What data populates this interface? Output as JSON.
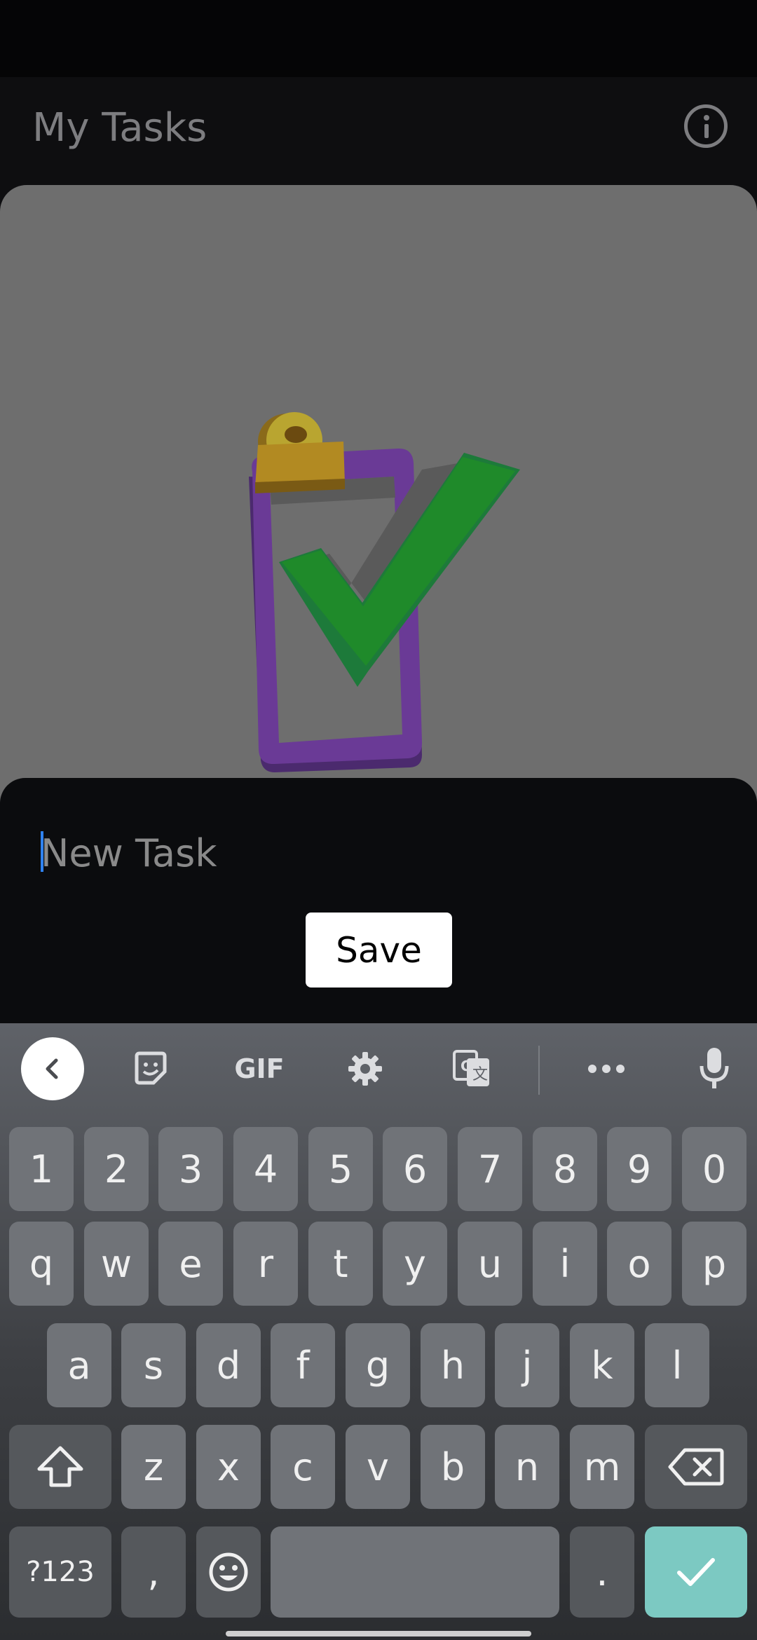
{
  "app": {
    "title": "My Tasks",
    "info_icon": "info-circle-icon"
  },
  "task_sheet": {
    "input_placeholder": "New Task",
    "input_value": "",
    "save_label": "Save"
  },
  "keyboard": {
    "toolbar": [
      "collapse-icon",
      "sticker-icon",
      "gif-icon",
      "gear-icon",
      "translate-icon",
      "more-icon",
      "microphone-icon"
    ],
    "gif_label": "GIF",
    "row_numbers": [
      "1",
      "2",
      "3",
      "4",
      "5",
      "6",
      "7",
      "8",
      "9",
      "0"
    ],
    "row1": [
      "q",
      "w",
      "e",
      "r",
      "t",
      "y",
      "u",
      "i",
      "o",
      "p"
    ],
    "row2": [
      "a",
      "s",
      "d",
      "f",
      "g",
      "h",
      "j",
      "k",
      "l"
    ],
    "row3": [
      "z",
      "x",
      "c",
      "v",
      "b",
      "n",
      "m"
    ],
    "symbols_label": "?123",
    "comma": ",",
    "period": "."
  },
  "colors": {
    "accent_key": "#7cc9c2",
    "cursor": "#2f82ef"
  }
}
